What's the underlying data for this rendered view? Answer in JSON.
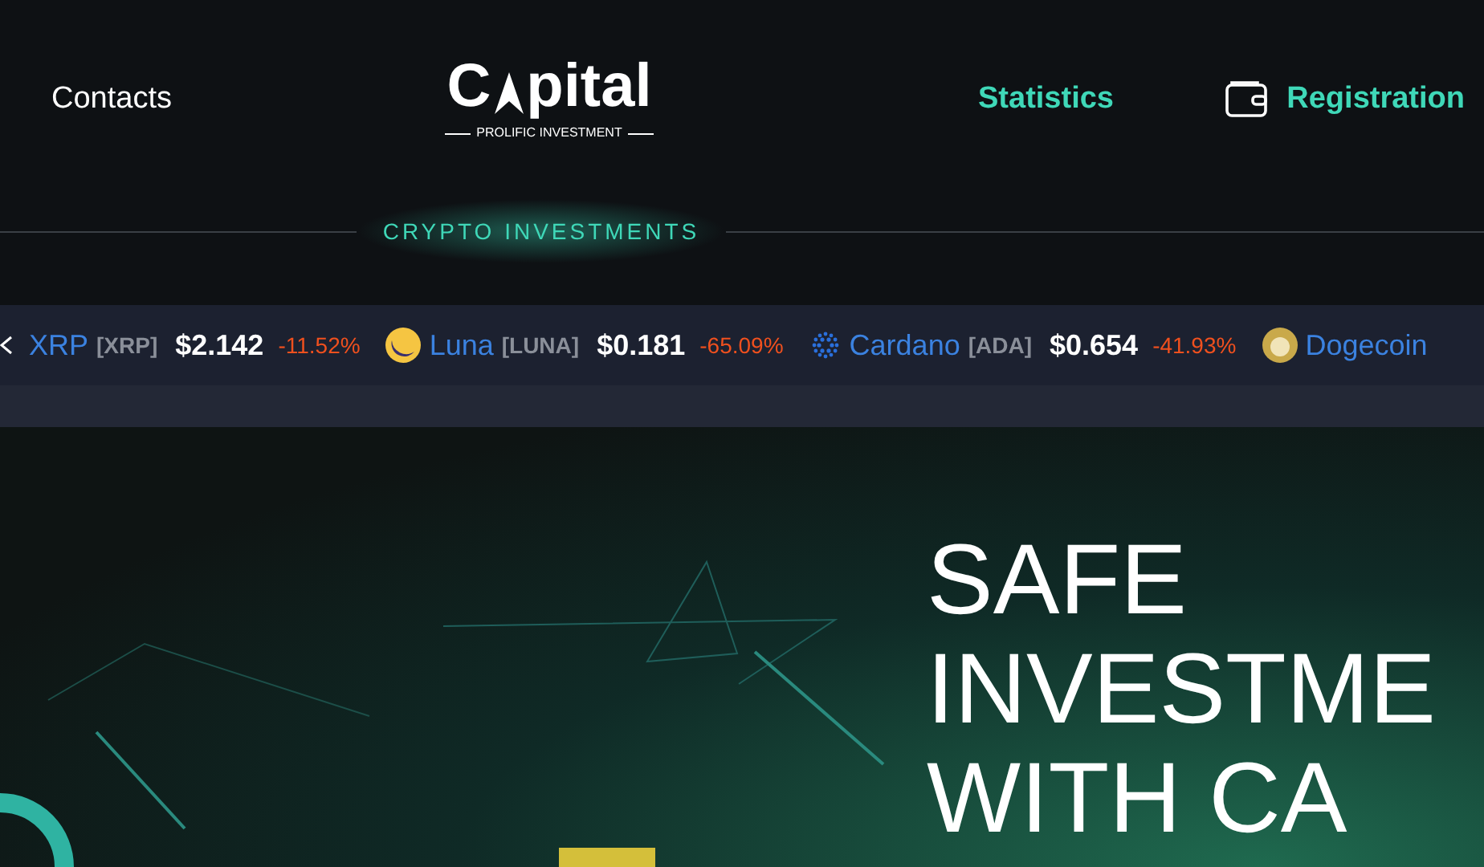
{
  "nav": {
    "left": "Contacts",
    "logo": {
      "prefix": "C",
      "suffix": "pital",
      "tagline": "PROLIFIC INVESTMENT"
    },
    "links": [
      "Statistics",
      "Registration"
    ],
    "section_label": "CRYPTO INVESTMENTS"
  },
  "ticker": [
    {
      "name": "XRP",
      "symbol": "[XRP]",
      "price": "$2.142",
      "change": "-11.52%",
      "kind": "none"
    },
    {
      "name": "Luna",
      "symbol": "[LUNA]",
      "price": "$0.181",
      "change": "-65.09%",
      "kind": "luna"
    },
    {
      "name": "Cardano",
      "symbol": "[ADA]",
      "price": "$0.654",
      "change": "-41.93%",
      "kind": "cardano"
    },
    {
      "name": "Dogecoin",
      "kind": "doge"
    }
  ],
  "hero": {
    "lines": [
      "SAFE",
      "INVESTME",
      "WITH CA"
    ]
  }
}
